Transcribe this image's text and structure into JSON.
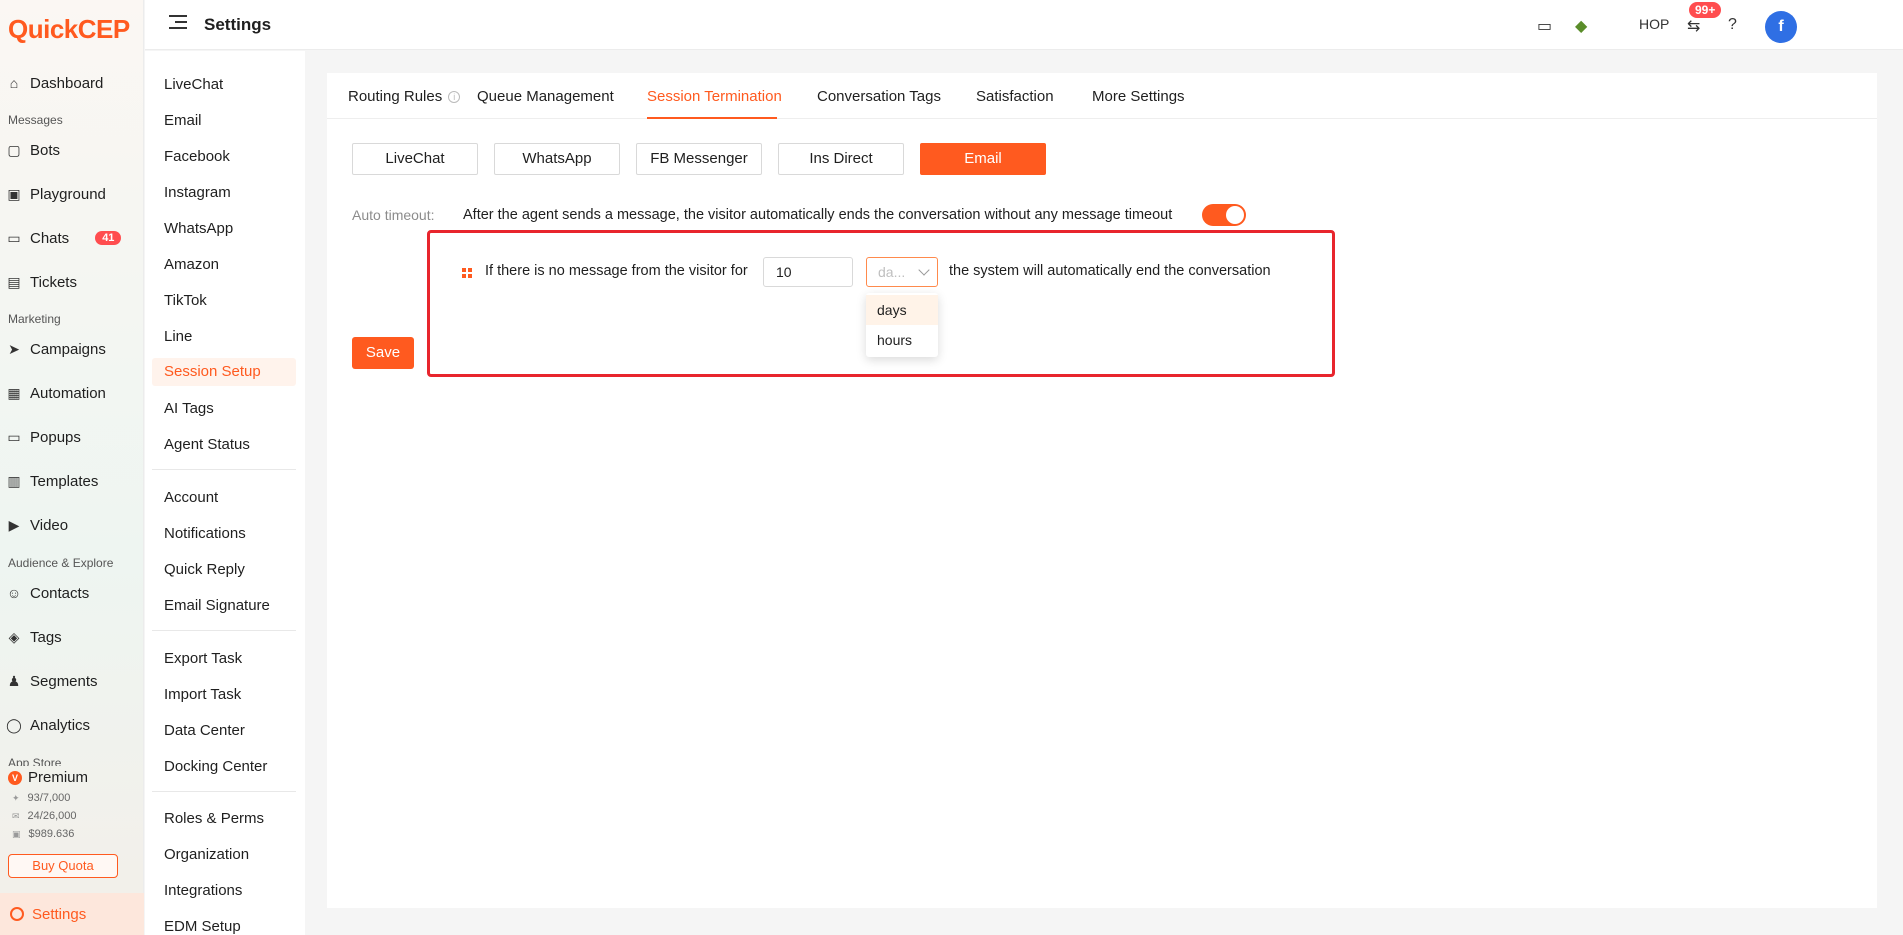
{
  "app": {
    "logo_q": "Q",
    "logo_uick": "uick",
    "logo_cep": "CEP"
  },
  "nav": {
    "dashboard": "Dashboard",
    "section_messages": "Messages",
    "bots": "Bots",
    "playground": "Playground",
    "chats": "Chats",
    "chats_badge": "41",
    "tickets": "Tickets",
    "section_marketing": "Marketing",
    "campaigns": "Campaigns",
    "automation": "Automation",
    "popups": "Popups",
    "templates": "Templates",
    "video": "Video",
    "section_audience": "Audience & Explore",
    "contacts": "Contacts",
    "tags": "Tags",
    "segments": "Segments",
    "analytics": "Analytics",
    "section_appstore": "App Store",
    "settings": "Settings"
  },
  "premium": {
    "title": "Premium",
    "row1": "93/7,000",
    "row2": "24/26,000",
    "row3": "$989.636",
    "buy_quota": "Buy Quota"
  },
  "topbar": {
    "title": "Settings",
    "shop": "HOP",
    "notify_badge": "99+",
    "avatar_letter": "f"
  },
  "settings_menu": {
    "group1": [
      "LiveChat",
      "Email",
      "Facebook",
      "Instagram",
      "WhatsApp",
      "Amazon",
      "TikTok",
      "Line",
      "Session Setup",
      "AI Tags",
      "Agent Status"
    ],
    "group2": [
      "Account",
      "Notifications",
      "Quick Reply",
      "Email Signature"
    ],
    "group3": [
      "Export Task",
      "Import Task",
      "Data Center",
      "Docking Center"
    ],
    "group4": [
      "Roles & Perms",
      "Organization",
      "Integrations",
      "EDM Setup"
    ]
  },
  "tabs": [
    "Routing Rules",
    "Queue Management",
    "Session Termination",
    "Conversation Tags",
    "Satisfaction",
    "More Settings"
  ],
  "channels": [
    "LiveChat",
    "WhatsApp",
    "FB Messenger",
    "Ins Direct",
    "Email"
  ],
  "auto_timeout": {
    "label": "Auto timeout:",
    "description": "After the agent sends a message, the visitor automatically ends the conversation without any message timeout",
    "enabled": true
  },
  "condition": {
    "prefix": "If there is no message from the visitor for",
    "value": "10",
    "unit_placeholder": "da...",
    "suffix": "the system will automatically end the conversation",
    "unit_options": [
      "days",
      "hours"
    ]
  },
  "save_label": "Save",
  "colors": {
    "accent": "#ff5a1f",
    "highlight_box": "#e8252d",
    "badge": "#ff4d4f",
    "avatar": "#2f6fe4"
  }
}
